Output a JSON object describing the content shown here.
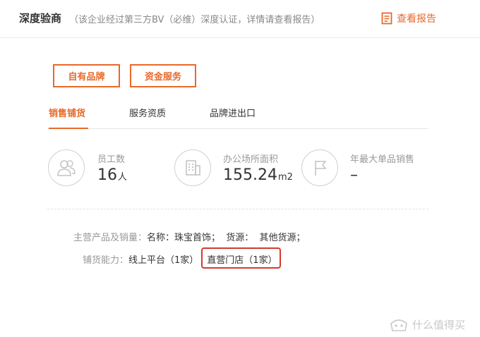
{
  "header": {
    "title": "深度验商",
    "subtitle": "（该企业经过第三方BV（必维）深度认证，详情请查看报告）",
    "report_link": "查看报告"
  },
  "chips": [
    "自有品牌",
    "资金服务"
  ],
  "tabs": [
    {
      "label": "销售铺货",
      "active": true
    },
    {
      "label": "服务资质",
      "active": false
    },
    {
      "label": "品牌进出口",
      "active": false
    }
  ],
  "stats": [
    {
      "label": "员工数",
      "value": "16",
      "unit": "人",
      "icon": "people-icon"
    },
    {
      "label": "办公场所面积",
      "value": "155.24",
      "unit": "m2",
      "icon": "building-icon"
    },
    {
      "label": "年最大单品销售",
      "value": "–",
      "unit": "",
      "icon": "flag-icon"
    }
  ],
  "info": {
    "products_label": "主营产品及销量：",
    "products_value": "名称：珠宝首饰；  货源：  其他货源；",
    "channels_label": "铺货能力：",
    "channel_online": "线上平台（1家）",
    "channel_store": "直营门店（1家）"
  },
  "watermark": {
    "text": "什么值得买",
    "icon": "smzdm-logo-icon"
  },
  "colors": {
    "accent": "#e8692a",
    "highlight": "#d33a2c"
  }
}
